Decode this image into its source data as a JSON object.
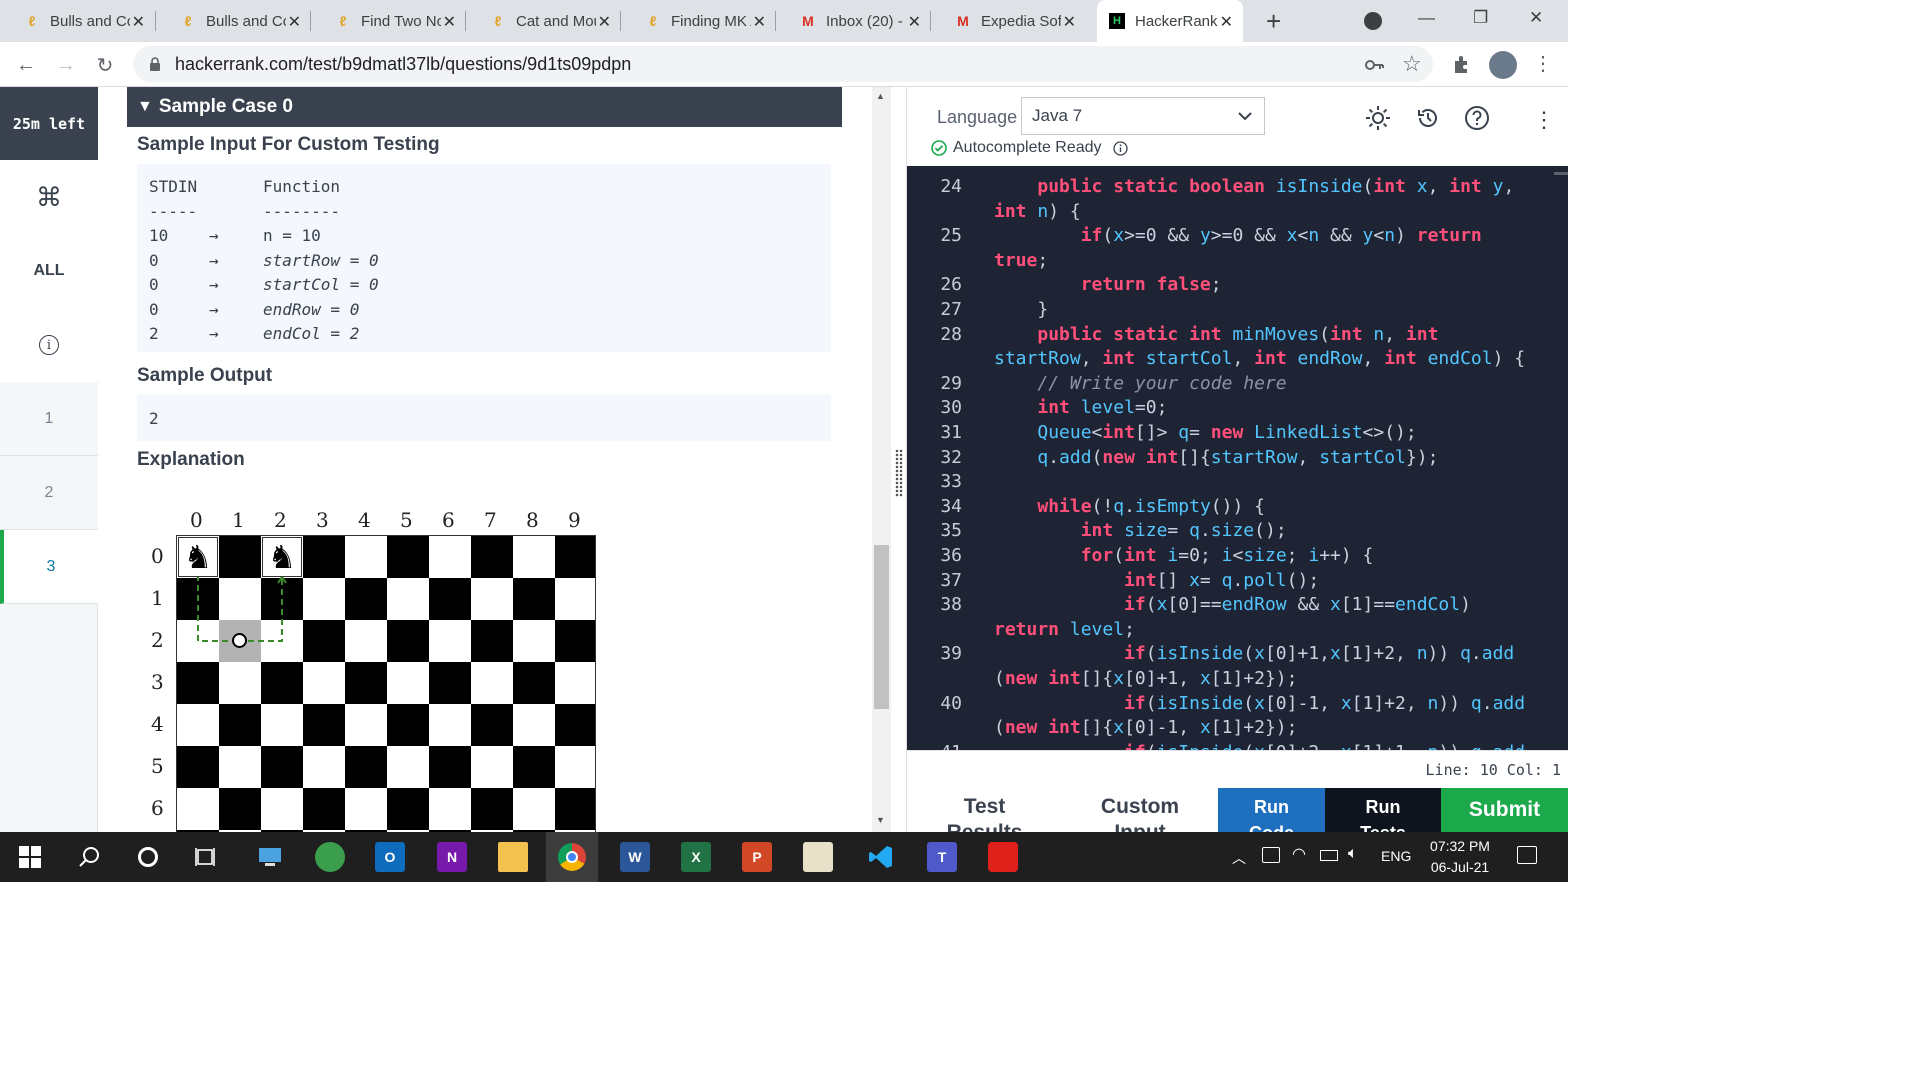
{
  "browser": {
    "tabs": [
      {
        "title": "Bulls and Cows",
        "icon": "leetcode-icon"
      },
      {
        "title": "Bulls and Cows",
        "icon": "leetcode-icon"
      },
      {
        "title": "Find Two Non-overlapping",
        "icon": "leetcode-icon"
      },
      {
        "title": "Cat and Mouse",
        "icon": "leetcode-icon"
      },
      {
        "title": "Finding MK Average",
        "icon": "leetcode-icon"
      },
      {
        "title": "Inbox (20) -",
        "icon": "gmail-icon"
      },
      {
        "title": "Expedia Software",
        "icon": "gmail-icon"
      },
      {
        "title": "HackerRank",
        "icon": "hackerrank-icon",
        "active": true
      }
    ],
    "new_tab": "+",
    "url": "hackerrank.com/test/b9dmatl37lb/questions/9d1ts09pdpn"
  },
  "sidebar": {
    "time_left": "25m left",
    "items": [
      {
        "label": "⌘",
        "name": "command-icon"
      },
      {
        "label": "ALL",
        "name": "all"
      },
      {
        "label": "i",
        "name": "info-icon"
      },
      {
        "label": "1",
        "name": "question-1"
      },
      {
        "label": "2",
        "name": "question-2"
      },
      {
        "label": "3",
        "name": "question-3"
      }
    ]
  },
  "question": {
    "sample_case": "Sample Case 0",
    "sample_input_heading": "Sample Input For Custom Testing",
    "stdin_header": "STDIN",
    "function_header": "Function",
    "stdin_rule": "-----",
    "function_rule": "--------",
    "input_rows": [
      {
        "stdin": "10",
        "arrow": "→",
        "func_name": "n",
        "eq": " = ",
        "val": "10",
        "italic": false
      },
      {
        "stdin": "0",
        "arrow": "→",
        "func_name": "startRow",
        "eq": " = ",
        "val": "0",
        "italic": true
      },
      {
        "stdin": "0",
        "arrow": "→",
        "func_name": "startCol",
        "eq": " = ",
        "val": "0",
        "italic": true
      },
      {
        "stdin": "0",
        "arrow": "→",
        "func_name": "endRow",
        "eq": " = ",
        "val": "0",
        "italic": true
      },
      {
        "stdin": "2",
        "arrow": "→",
        "func_name": "endCol",
        "eq": " = ",
        "val": "2",
        "italic": true
      }
    ],
    "sample_output_heading": "Sample Output",
    "sample_output": "2",
    "explanation_heading": "Explanation",
    "board": {
      "cols": [
        "0",
        "1",
        "2",
        "3",
        "4",
        "5",
        "6",
        "7",
        "8",
        "9"
      ],
      "rows": [
        "0",
        "1",
        "2",
        "3",
        "4",
        "5",
        "6"
      ],
      "knights": [
        {
          "row": 0,
          "col": 0
        },
        {
          "row": 0,
          "col": 2
        }
      ],
      "intermediate": {
        "row": 2,
        "col": 1
      },
      "knight_glyph": "♞",
      "dark_color": "#000000",
      "light_color": "#ffffff",
      "path_color": "#3a8a2a"
    }
  },
  "editor": {
    "language_label": "Language",
    "language": "Java 7",
    "autocomplete": "Autocomplete Ready",
    "status": "Line: 10 Col: 1",
    "lines": [
      {
        "n": "24",
        "code": [
          [
            "    ",
            ""
          ],
          [
            "public",
            "kw"
          ],
          [
            " ",
            ""
          ],
          [
            "static",
            "kw"
          ],
          [
            " ",
            ""
          ],
          [
            "boolean",
            "ty"
          ],
          [
            " ",
            ""
          ],
          [
            "isInside",
            "fn"
          ],
          [
            "(",
            ""
          ],
          [
            "int",
            "ty"
          ],
          [
            " ",
            ""
          ],
          [
            "x",
            "va"
          ],
          [
            ", ",
            ""
          ],
          [
            "int",
            "ty"
          ],
          [
            " ",
            ""
          ],
          [
            "y",
            "va"
          ],
          [
            ",",
            ""
          ]
        ]
      },
      {
        "n": "",
        "code": [
          [
            "int",
            "ty"
          ],
          [
            " ",
            ""
          ],
          [
            "n",
            "va"
          ],
          [
            ") {",
            ""
          ]
        ]
      },
      {
        "n": "25",
        "code": [
          [
            "        ",
            ""
          ],
          [
            "if",
            "kw"
          ],
          [
            "(",
            ""
          ],
          [
            "x",
            "va"
          ],
          [
            ">=0 && ",
            ""
          ],
          [
            "y",
            "va"
          ],
          [
            ">=0 && ",
            ""
          ],
          [
            "x",
            "va"
          ],
          [
            "<",
            ""
          ],
          [
            "n",
            "va"
          ],
          [
            " && ",
            ""
          ],
          [
            "y",
            "va"
          ],
          [
            "<",
            ""
          ],
          [
            "n",
            "va"
          ],
          [
            ") ",
            ""
          ],
          [
            "return",
            "kw"
          ]
        ]
      },
      {
        "n": "",
        "code": [
          [
            "true",
            "kw"
          ],
          [
            ";",
            ""
          ]
        ]
      },
      {
        "n": "26",
        "code": [
          [
            "        ",
            ""
          ],
          [
            "return",
            "kw"
          ],
          [
            " ",
            ""
          ],
          [
            "false",
            "kw"
          ],
          [
            ";",
            ""
          ]
        ]
      },
      {
        "n": "27",
        "code": [
          [
            "    }",
            ""
          ]
        ]
      },
      {
        "n": "28",
        "code": [
          [
            "    ",
            ""
          ],
          [
            "public",
            "kw"
          ],
          [
            " ",
            ""
          ],
          [
            "static",
            "kw"
          ],
          [
            " ",
            ""
          ],
          [
            "int",
            "ty"
          ],
          [
            " ",
            ""
          ],
          [
            "minMoves",
            "fn"
          ],
          [
            "(",
            ""
          ],
          [
            "int",
            "ty"
          ],
          [
            " ",
            ""
          ],
          [
            "n",
            "va"
          ],
          [
            ", ",
            ""
          ],
          [
            "int",
            "ty"
          ]
        ]
      },
      {
        "n": "",
        "code": [
          [
            "startRow",
            "va"
          ],
          [
            ", ",
            ""
          ],
          [
            "int",
            "ty"
          ],
          [
            " ",
            ""
          ],
          [
            "startCol",
            "va"
          ],
          [
            ", ",
            ""
          ],
          [
            "int",
            "ty"
          ],
          [
            " ",
            ""
          ],
          [
            "endRow",
            "va"
          ],
          [
            ", ",
            ""
          ],
          [
            "int",
            "ty"
          ],
          [
            " ",
            ""
          ],
          [
            "endCol",
            "va"
          ],
          [
            ") {",
            ""
          ]
        ]
      },
      {
        "n": "29",
        "code": [
          [
            "    ",
            ""
          ],
          [
            "// Write your code here",
            "cm"
          ]
        ]
      },
      {
        "n": "30",
        "code": [
          [
            "    ",
            ""
          ],
          [
            "int",
            "ty"
          ],
          [
            " ",
            ""
          ],
          [
            "level",
            "va"
          ],
          [
            "=0;",
            ""
          ]
        ]
      },
      {
        "n": "31",
        "code": [
          [
            "    ",
            ""
          ],
          [
            "Queue",
            "fn"
          ],
          [
            "<",
            ""
          ],
          [
            "int",
            "ty"
          ],
          [
            "[]> ",
            ""
          ],
          [
            "q",
            "va"
          ],
          [
            "= ",
            ""
          ],
          [
            "new",
            "kw"
          ],
          [
            " ",
            ""
          ],
          [
            "LinkedList",
            "fn"
          ],
          [
            "<>();",
            ""
          ]
        ]
      },
      {
        "n": "32",
        "code": [
          [
            "    ",
            ""
          ],
          [
            "q",
            "va"
          ],
          [
            ".",
            ""
          ],
          [
            "add",
            "fn"
          ],
          [
            "(",
            ""
          ],
          [
            "new",
            "kw"
          ],
          [
            " ",
            ""
          ],
          [
            "int",
            "ty"
          ],
          [
            "[]{",
            ""
          ],
          [
            "startRow",
            "va"
          ],
          [
            ", ",
            ""
          ],
          [
            "startCol",
            "va"
          ],
          [
            "});",
            ""
          ]
        ]
      },
      {
        "n": "33",
        "code": [
          [
            "",
            ""
          ]
        ]
      },
      {
        "n": "34",
        "code": [
          [
            "    ",
            ""
          ],
          [
            "while",
            "kw"
          ],
          [
            "(!",
            ""
          ],
          [
            "q",
            "va"
          ],
          [
            ".",
            ""
          ],
          [
            "isEmpty",
            "fn"
          ],
          [
            "()) {",
            ""
          ]
        ]
      },
      {
        "n": "35",
        "code": [
          [
            "        ",
            ""
          ],
          [
            "int",
            "ty"
          ],
          [
            " ",
            ""
          ],
          [
            "size",
            "va"
          ],
          [
            "= ",
            ""
          ],
          [
            "q",
            "va"
          ],
          [
            ".",
            ""
          ],
          [
            "size",
            "fn"
          ],
          [
            "();",
            ""
          ]
        ]
      },
      {
        "n": "36",
        "code": [
          [
            "        ",
            ""
          ],
          [
            "for",
            "kw"
          ],
          [
            "(",
            ""
          ],
          [
            "int",
            "ty"
          ],
          [
            " ",
            ""
          ],
          [
            "i",
            "va"
          ],
          [
            "=0; ",
            ""
          ],
          [
            "i",
            "va"
          ],
          [
            "<",
            ""
          ],
          [
            "size",
            "va"
          ],
          [
            "; ",
            ""
          ],
          [
            "i",
            "va"
          ],
          [
            "++) {",
            ""
          ]
        ]
      },
      {
        "n": "37",
        "code": [
          [
            "            ",
            ""
          ],
          [
            "int",
            "ty"
          ],
          [
            "[] ",
            ""
          ],
          [
            "x",
            "va"
          ],
          [
            "= ",
            ""
          ],
          [
            "q",
            "va"
          ],
          [
            ".",
            ""
          ],
          [
            "poll",
            "fn"
          ],
          [
            "();",
            ""
          ]
        ]
      },
      {
        "n": "38",
        "code": [
          [
            "            ",
            ""
          ],
          [
            "if",
            "kw"
          ],
          [
            "(",
            ""
          ],
          [
            "x",
            "va"
          ],
          [
            "[0]==",
            ""
          ],
          [
            "endRow",
            "va"
          ],
          [
            " && ",
            ""
          ],
          [
            "x",
            "va"
          ],
          [
            "[1]==",
            ""
          ],
          [
            "endCol",
            "va"
          ],
          [
            ")",
            ""
          ]
        ]
      },
      {
        "n": "",
        "code": [
          [
            "return",
            "kw"
          ],
          [
            " ",
            ""
          ],
          [
            "level",
            "va"
          ],
          [
            ";",
            ""
          ]
        ]
      },
      {
        "n": "39",
        "code": [
          [
            "            ",
            ""
          ],
          [
            "if",
            "kw"
          ],
          [
            "(",
            ""
          ],
          [
            "isInside",
            "fn"
          ],
          [
            "(",
            ""
          ],
          [
            "x",
            "va"
          ],
          [
            "[0]+1,",
            ""
          ],
          [
            "x",
            "va"
          ],
          [
            "[1]+2, ",
            ""
          ],
          [
            "n",
            "va"
          ],
          [
            ")) ",
            ""
          ],
          [
            "q",
            "va"
          ],
          [
            ".",
            ""
          ],
          [
            "add",
            "fn"
          ]
        ]
      },
      {
        "n": "",
        "code": [
          [
            "(",
            ""
          ],
          [
            "new",
            "kw"
          ],
          [
            " ",
            ""
          ],
          [
            "int",
            "ty"
          ],
          [
            "[]{",
            ""
          ],
          [
            "x",
            "va"
          ],
          [
            "[0]+1, ",
            ""
          ],
          [
            "x",
            "va"
          ],
          [
            "[1]+2});",
            ""
          ]
        ]
      },
      {
        "n": "40",
        "code": [
          [
            "            ",
            ""
          ],
          [
            "if",
            "kw"
          ],
          [
            "(",
            ""
          ],
          [
            "isInside",
            "fn"
          ],
          [
            "(",
            ""
          ],
          [
            "x",
            "va"
          ],
          [
            "[0]-1, ",
            ""
          ],
          [
            "x",
            "va"
          ],
          [
            "[1]+2, ",
            ""
          ],
          [
            "n",
            "va"
          ],
          [
            ")) ",
            ""
          ],
          [
            "q",
            "va"
          ],
          [
            ".",
            ""
          ],
          [
            "add",
            "fn"
          ]
        ]
      },
      {
        "n": "",
        "code": [
          [
            "(",
            ""
          ],
          [
            "new",
            "kw"
          ],
          [
            " ",
            ""
          ],
          [
            "int",
            "ty"
          ],
          [
            "[]{",
            ""
          ],
          [
            "x",
            "va"
          ],
          [
            "[0]-1, ",
            ""
          ],
          [
            "x",
            "va"
          ],
          [
            "[1]+2});",
            ""
          ]
        ]
      },
      {
        "n": "41",
        "code": [
          [
            "            ",
            ""
          ],
          [
            "if",
            "kw"
          ],
          [
            "(",
            ""
          ],
          [
            "isInside",
            "fn"
          ],
          [
            "(",
            ""
          ],
          [
            "x",
            "va"
          ],
          [
            "[0]+2, ",
            ""
          ],
          [
            "x",
            "va"
          ],
          [
            "[1]+1, ",
            ""
          ],
          [
            "n",
            "va"
          ],
          [
            ")) ",
            ""
          ],
          [
            "q",
            "va"
          ],
          [
            ".",
            ""
          ],
          [
            "add",
            "fn"
          ]
        ]
      }
    ]
  },
  "bottom_buttons": [
    {
      "label": "Test Results",
      "name": "test-results-tab",
      "bg": "#ffffff",
      "fg": "#39424e"
    },
    {
      "label": "Custom Input",
      "name": "custom-input-tab",
      "bg": "#ffffff",
      "fg": "#39424e"
    },
    {
      "label": "Run Code",
      "name": "run-code-button",
      "bg": "#1f6fbf",
      "fg": "#ffffff"
    },
    {
      "label": "Run Tests",
      "name": "run-tests-button",
      "bg": "#0e141e",
      "fg": "#ffffff"
    },
    {
      "label": "Submit",
      "name": "submit-button",
      "bg": "#1ba94c",
      "fg": "#ffffff"
    }
  ],
  "taskbar": {
    "time": "07:32 PM",
    "date": "06-Jul-21",
    "lang": "ENG",
    "apps": [
      {
        "name": "windows-start-icon"
      },
      {
        "name": "search-icon"
      },
      {
        "name": "cortana-icon"
      },
      {
        "name": "task-view-icon"
      },
      {
        "name": "network-pc-icon"
      },
      {
        "name": "globe-icon"
      },
      {
        "name": "outlook-icon",
        "label": "O",
        "color": "#0f6cbd"
      },
      {
        "name": "onenote-icon",
        "label": "N",
        "color": "#7719aa"
      },
      {
        "name": "file-explorer-icon",
        "color": "#f2c14e"
      },
      {
        "name": "chrome-icon"
      },
      {
        "name": "word-icon",
        "label": "W",
        "color": "#2b579a"
      },
      {
        "name": "excel-icon",
        "label": "X",
        "color": "#217346"
      },
      {
        "name": "powerpoint-icon",
        "label": "P",
        "color": "#d24726"
      },
      {
        "name": "paint-icon"
      },
      {
        "name": "vscode-icon"
      },
      {
        "name": "teams-icon",
        "label": "T",
        "color": "#5059c9"
      },
      {
        "name": "acrobat-icon",
        "color": "#e0201b"
      }
    ]
  }
}
